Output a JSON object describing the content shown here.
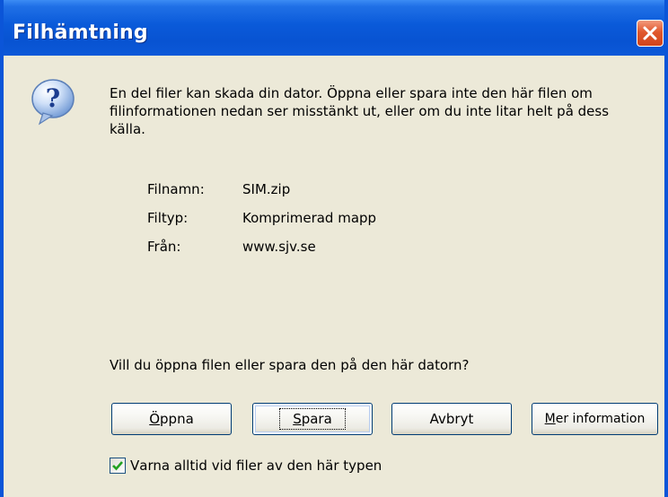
{
  "window": {
    "title": "Filhämtning"
  },
  "message": {
    "text": "En del filer kan skada din dator. Öppna eller spara inte den här filen om filinformationen nedan ser misstänkt ut, eller om du inte litar helt på dess källa."
  },
  "file_info": {
    "name_label": "Filnamn:",
    "name_value": "SIM.zip",
    "type_label": "Filtyp:",
    "type_value": "Komprimerad mapp",
    "from_label": "Från:",
    "from_value": "www.sjv.se"
  },
  "question": "Vill du öppna filen eller spara den på den här datorn?",
  "buttons": {
    "open_first": "Ö",
    "open_rest": "ppna",
    "save_first": "S",
    "save_rest": "para",
    "cancel": "Avbryt",
    "more_first": "M",
    "more_rest": "er information"
  },
  "checkbox": {
    "label_first": "V",
    "label_rest": "arna alltid vid filer av den här typen",
    "checked": true
  },
  "colors": {
    "titlebar": "#0a5ad9",
    "close_button": "#d2441a",
    "dialog_background": "#ece9d8",
    "checkmark": "#21a121"
  },
  "icons": {
    "dialog": "question-icon",
    "close": "close-icon",
    "check": "checkmark-icon"
  }
}
